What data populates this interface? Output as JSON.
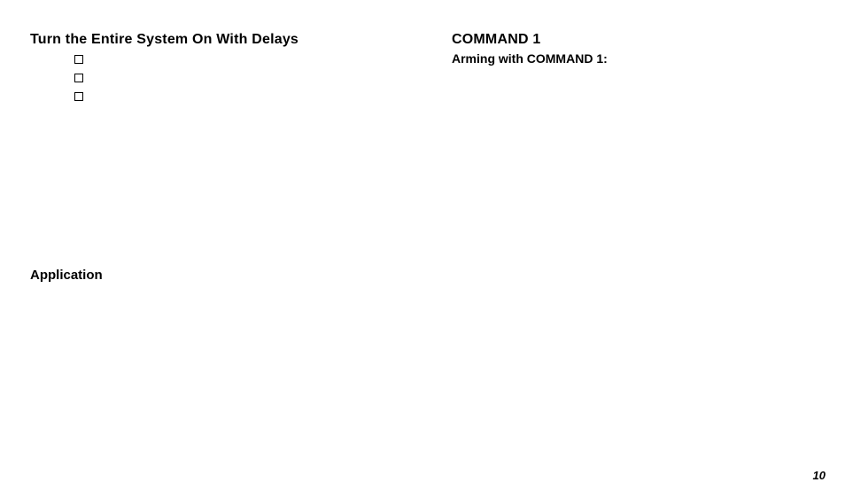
{
  "left_column": {
    "title": "Turn the Entire System On With Delays",
    "application_heading": "Application"
  },
  "right_column": {
    "command_heading": "COMMAND   1",
    "subheading": "Arming with COMMAND 1:"
  },
  "page_number": "10"
}
